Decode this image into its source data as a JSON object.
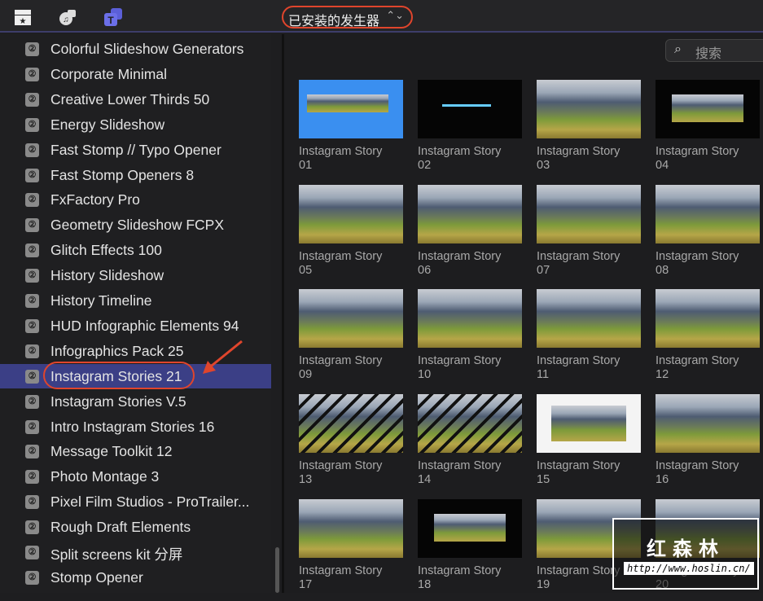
{
  "toolbar": {
    "icons": [
      "clapper-star-icon",
      "photos-music-icon",
      "titles-generators-icon"
    ],
    "generator_select": "已安装的发生器",
    "search_placeholder": "搜索"
  },
  "sidebar": {
    "selected_index": 13,
    "items": [
      {
        "label": "Colorful Slideshow Generators"
      },
      {
        "label": "Corporate Minimal"
      },
      {
        "label": "Creative Lower Thirds 50"
      },
      {
        "label": "Energy Slideshow"
      },
      {
        "label": "Fast Stomp // Typo Opener"
      },
      {
        "label": "Fast Stomp Openers 8"
      },
      {
        "label": "FxFactory Pro"
      },
      {
        "label": "Geometry Slideshow FCPX"
      },
      {
        "label": "Glitch Effects 100"
      },
      {
        "label": "History Slideshow"
      },
      {
        "label": "History Timeline"
      },
      {
        "label": "HUD Infographic Elements 94"
      },
      {
        "label": "Infographics Pack 25"
      },
      {
        "label": "Instagram Stories 21"
      },
      {
        "label": "Instagram Stories V.5"
      },
      {
        "label": "Intro Instagram Stories 16"
      },
      {
        "label": "Message Toolkit 12"
      },
      {
        "label": "Photo Montage 3"
      },
      {
        "label": "Pixel Film Studios - ProTrailer..."
      },
      {
        "label": "Rough Draft Elements"
      },
      {
        "label": "Split screens kit 分屏"
      },
      {
        "label": "Stomp Opener"
      }
    ]
  },
  "grid": {
    "items": [
      {
        "name": "Instagram Story",
        "num": "01",
        "style": "blue"
      },
      {
        "name": "Instagram Story",
        "num": "02",
        "style": "black"
      },
      {
        "name": "Instagram Story",
        "num": "03",
        "style": "land"
      },
      {
        "name": "Instagram Story",
        "num": "04",
        "style": "black-inset"
      },
      {
        "name": "Instagram Story",
        "num": "05",
        "style": "land"
      },
      {
        "name": "Instagram Story",
        "num": "06",
        "style": "land"
      },
      {
        "name": "Instagram Story",
        "num": "07",
        "style": "land"
      },
      {
        "name": "Instagram Story",
        "num": "08",
        "style": "land"
      },
      {
        "name": "Instagram Story",
        "num": "09",
        "style": "land"
      },
      {
        "name": "Instagram Story",
        "num": "10",
        "style": "land"
      },
      {
        "name": "Instagram Story",
        "num": "11",
        "style": "land"
      },
      {
        "name": "Instagram Story",
        "num": "12",
        "style": "land"
      },
      {
        "name": "Instagram Story",
        "num": "13",
        "style": "stripes"
      },
      {
        "name": "Instagram Story",
        "num": "14",
        "style": "stripes"
      },
      {
        "name": "Instagram Story",
        "num": "15",
        "style": "white-inset"
      },
      {
        "name": "Instagram Story",
        "num": "16",
        "style": "land"
      },
      {
        "name": "Instagram Story",
        "num": "17",
        "style": "land"
      },
      {
        "name": "Instagram Story",
        "num": "18",
        "style": "black-inset"
      },
      {
        "name": "Instagram Story",
        "num": "19",
        "style": "land"
      },
      {
        "name": "Instagram Story",
        "num": "20",
        "style": "land"
      }
    ]
  },
  "watermark": {
    "title": "红森林",
    "url": "http://www.hoslin.cn/"
  }
}
